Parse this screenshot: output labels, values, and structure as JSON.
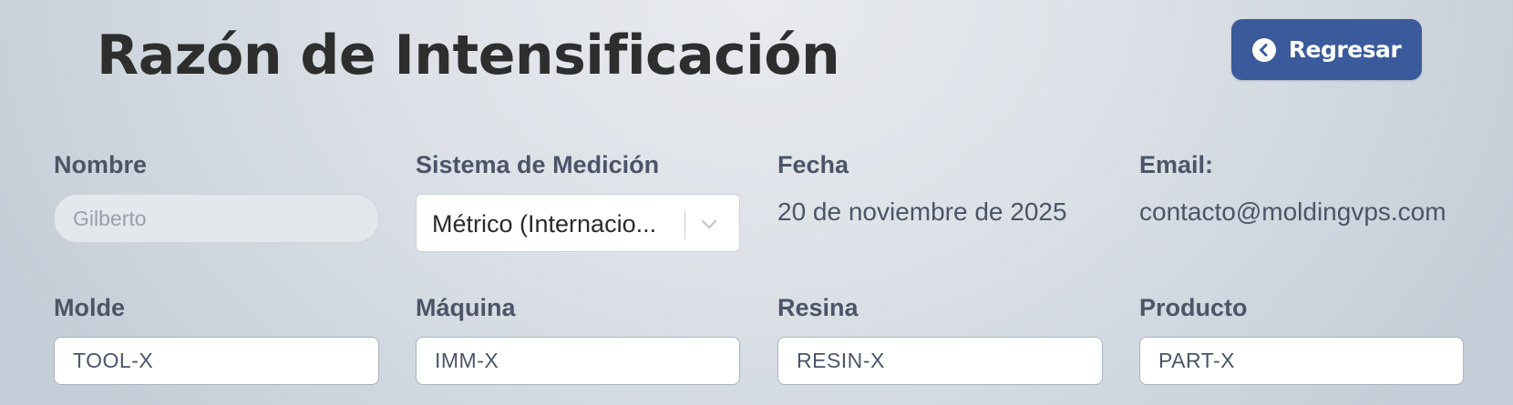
{
  "header": {
    "title": "Razón de Intensificación",
    "back_button": {
      "label": "Regresar",
      "icon": "chevron-left-circle-icon",
      "color": "#3a5a9c"
    }
  },
  "form": {
    "nombre": {
      "label": "Nombre",
      "placeholder": "Gilberto",
      "value": ""
    },
    "sistema_medicion": {
      "label": "Sistema de Medición",
      "selected": "Métrico (Internacio..."
    },
    "fecha": {
      "label": "Fecha",
      "value": "20 de noviembre de 2025"
    },
    "email": {
      "label": "Email:",
      "value": "contacto@moldingvps.com"
    },
    "molde": {
      "label": "Molde",
      "value": "TOOL-X"
    },
    "maquina": {
      "label": "Máquina",
      "value": "IMM-X"
    },
    "resina": {
      "label": "Resina",
      "value": "RESIN-X"
    },
    "producto": {
      "label": "Producto",
      "value": "PART-X"
    }
  }
}
